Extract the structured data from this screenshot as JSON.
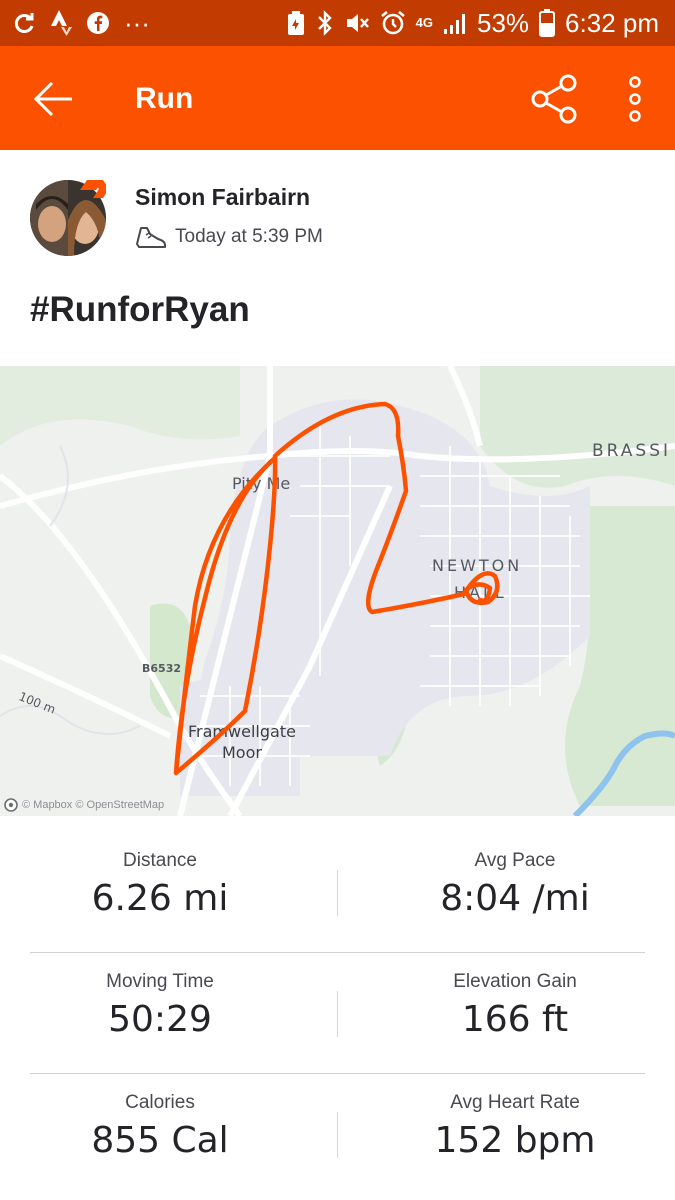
{
  "status_bar": {
    "battery_percent": "53%",
    "time": "6:32 pm",
    "network": "4G"
  },
  "app_bar": {
    "title": "Run",
    "icons": [
      "back-arrow-icon",
      "share-icon",
      "more-vert-icon"
    ]
  },
  "activity": {
    "athlete_name": "Simon Fairbairn",
    "time": "Today at 5:39 PM",
    "title": "#RunforRyan"
  },
  "map": {
    "labels": {
      "pity_me": "Pity Me",
      "framwellgate_1": "Framwellgate",
      "framwellgate_2": "Moor",
      "newton_1": "NEWTON",
      "newton_2": "HALL",
      "brassi": "BRASSI",
      "road": "B6532",
      "contour": "100 m"
    },
    "attribution": "© Mapbox © OpenStreetMap",
    "route_color": "#fc5200"
  },
  "stats": [
    {
      "label": "Distance",
      "value": "6.26 mi"
    },
    {
      "label": "Avg Pace",
      "value": "8:04 /mi"
    },
    {
      "label": "Moving Time",
      "value": "50:29"
    },
    {
      "label": "Elevation Gain",
      "value": "166 ft"
    },
    {
      "label": "Calories",
      "value": "855 Cal"
    },
    {
      "label": "Avg Heart Rate",
      "value": "152 bpm"
    }
  ],
  "colors": {
    "accent": "#fc5200",
    "status_bar": "#c23b00"
  }
}
